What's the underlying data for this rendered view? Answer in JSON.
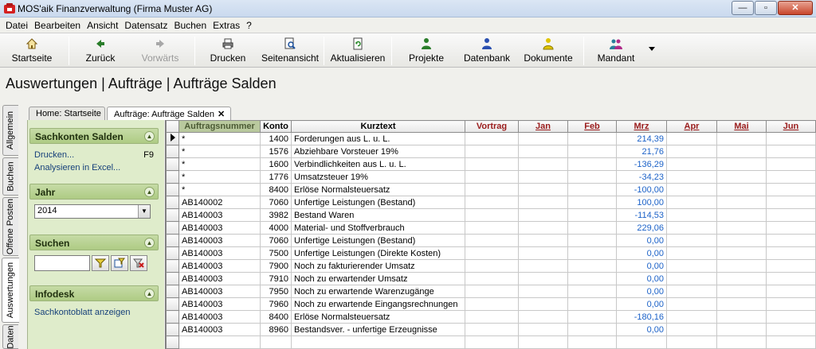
{
  "window": {
    "title": "MOS'aik Finanzverwaltung (Firma Muster AG)",
    "minimize": "—",
    "maximize": "▫",
    "close": "✕"
  },
  "menu": [
    {
      "label": "Datei"
    },
    {
      "label": "Bearbeiten"
    },
    {
      "label": "Ansicht"
    },
    {
      "label": "Datensatz"
    },
    {
      "label": "Buchen"
    },
    {
      "label": "Extras"
    },
    {
      "label": "?"
    }
  ],
  "toolbar": {
    "startseite": "Startseite",
    "zurueck": "Zurück",
    "vorwaerts": "Vorwärts",
    "drucken": "Drucken",
    "seitenansicht": "Seitenansicht",
    "aktualisieren": "Aktualisieren",
    "projekte": "Projekte",
    "datenbank": "Datenbank",
    "dokumente": "Dokumente",
    "mandant": "Mandant"
  },
  "page": {
    "title": "Auswertungen | Aufträge | Aufträge Salden"
  },
  "vtabs": [
    "Allgemein",
    "Buchen",
    "Offene Posten",
    "Auswertungen",
    "Daten"
  ],
  "doctabs": {
    "home": "Home: Startseite",
    "current": "Aufträge: Aufträge Salden"
  },
  "panel": {
    "sachkonten": {
      "title": "Sachkonten Salden",
      "drucken": "Drucken...",
      "drucken_key": "F9",
      "excel": "Analysieren in Excel..."
    },
    "jahr": {
      "title": "Jahr",
      "value": "2014"
    },
    "suchen": {
      "title": "Suchen",
      "value": ""
    },
    "infodesk": {
      "title": "Infodesk",
      "link": "Sachkontoblatt anzeigen"
    }
  },
  "grid": {
    "headers": {
      "auftrag": "Auftragsnummer",
      "konto": "Konto",
      "kurztext": "Kurztext",
      "vortrag": "Vortrag",
      "jan": "Jan",
      "feb": "Feb",
      "mrz": "Mrz",
      "apr": "Apr",
      "mai": "Mai",
      "jun": "Jun"
    },
    "rows": [
      {
        "auftrag": "*",
        "konto": "1400",
        "kurztext": "Forderungen aus L. u. L.",
        "mrz": "214,39"
      },
      {
        "auftrag": "*",
        "konto": "1576",
        "kurztext": "Abziehbare Vorsteuer 19%",
        "mrz": "21,76"
      },
      {
        "auftrag": "*",
        "konto": "1600",
        "kurztext": "Verbindlichkeiten aus L. u. L.",
        "mrz": "-136,29"
      },
      {
        "auftrag": "*",
        "konto": "1776",
        "kurztext": "Umsatzsteuer 19%",
        "mrz": "-34,23"
      },
      {
        "auftrag": "*",
        "konto": "8400",
        "kurztext": "Erlöse Normalsteuersatz",
        "mrz": "-100,00"
      },
      {
        "auftrag": "AB140002",
        "konto": "7060",
        "kurztext": "Unfertige Leistungen (Bestand)",
        "mrz": "100,00"
      },
      {
        "auftrag": "AB140003",
        "konto": "3982",
        "kurztext": "Bestand Waren",
        "mrz": "-114,53"
      },
      {
        "auftrag": "AB140003",
        "konto": "4000",
        "kurztext": "Material- und Stoffverbrauch",
        "mrz": "229,06"
      },
      {
        "auftrag": "AB140003",
        "konto": "7060",
        "kurztext": "Unfertige Leistungen (Bestand)",
        "mrz": "0,00"
      },
      {
        "auftrag": "AB140003",
        "konto": "7500",
        "kurztext": "Unfertige Leistungen (Direkte Kosten)",
        "mrz": "0,00"
      },
      {
        "auftrag": "AB140003",
        "konto": "7900",
        "kurztext": "Noch zu fakturierender Umsatz",
        "mrz": "0,00"
      },
      {
        "auftrag": "AB140003",
        "konto": "7910",
        "kurztext": "Noch zu erwartender Umsatz",
        "mrz": "0,00"
      },
      {
        "auftrag": "AB140003",
        "konto": "7950",
        "kurztext": "Noch zu erwartende Warenzugänge",
        "mrz": "0,00"
      },
      {
        "auftrag": "AB140003",
        "konto": "7960",
        "kurztext": "Noch zu erwartende Eingangsrechnungen",
        "mrz": "0,00"
      },
      {
        "auftrag": "AB140003",
        "konto": "8400",
        "kurztext": "Erlöse Normalsteuersatz",
        "mrz": "-180,16"
      },
      {
        "auftrag": "AB140003",
        "konto": "8960",
        "kurztext": "Bestandsver. - unfertige Erzeugnisse",
        "mrz": "0,00"
      }
    ]
  },
  "colors": {
    "panel_bg": "#dfeccb",
    "panel_header": "#aecb84",
    "value_blue": "#1c62c8",
    "month_red": "#9a1c1c"
  }
}
